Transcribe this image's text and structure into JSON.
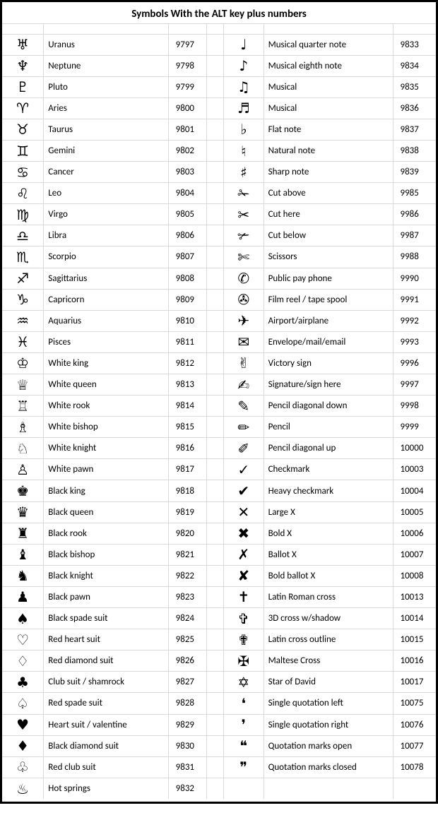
{
  "title": "Symbols With the ALT key plus numbers",
  "rows": [
    {
      "l": [
        "♅",
        "Uranus",
        "9797"
      ],
      "r": [
        "♩",
        "Musical quarter note",
        "9833"
      ]
    },
    {
      "l": [
        "♆",
        "Neptune",
        "9798"
      ],
      "r": [
        "♪",
        "Musical eighth note",
        "9834"
      ]
    },
    {
      "l": [
        "♇",
        "Pluto",
        "9799"
      ],
      "r": [
        "♫",
        "Musical",
        "9835"
      ]
    },
    {
      "l": [
        "♈",
        "Aries",
        "9800"
      ],
      "r": [
        "♬",
        "Musical",
        "9836"
      ]
    },
    {
      "l": [
        "♉",
        "Taurus",
        "9801"
      ],
      "r": [
        "♭",
        "Flat note",
        "9837"
      ]
    },
    {
      "l": [
        "♊",
        "Gemini",
        "9802"
      ],
      "r": [
        "♮",
        "Natural note",
        "9838"
      ]
    },
    {
      "l": [
        "♋",
        "Cancer",
        "9803"
      ],
      "r": [
        "♯",
        "Sharp note",
        "9839"
      ]
    },
    {
      "l": [
        "♌",
        "Leo",
        "9804"
      ],
      "r": [
        "✁",
        "Cut above",
        "9985"
      ]
    },
    {
      "l": [
        "♍",
        "Virgo",
        "9805"
      ],
      "r": [
        "✂",
        "Cut here",
        "9986"
      ]
    },
    {
      "l": [
        "♎",
        "Libra",
        "9806"
      ],
      "r": [
        "✃",
        "Cut below",
        "9987"
      ]
    },
    {
      "l": [
        "♏",
        "Scorpio",
        "9807"
      ],
      "r": [
        "✄",
        "Scissors",
        "9988"
      ]
    },
    {
      "l": [
        "♐",
        "Sagittarius",
        "9808"
      ],
      "r": [
        "✆",
        "Public pay phone",
        "9990"
      ]
    },
    {
      "l": [
        "♑",
        "Capricorn",
        "9809"
      ],
      "r": [
        "✇",
        "Film reel / tape spool",
        "9991"
      ]
    },
    {
      "l": [
        "♒",
        "Aquarius",
        "9810"
      ],
      "r": [
        "✈",
        "Airport/airplane",
        "9992"
      ]
    },
    {
      "l": [
        "♓",
        "Pisces",
        "9811"
      ],
      "r": [
        "✉",
        "Envelope/mail/email",
        "9993"
      ]
    },
    {
      "l": [
        "♔",
        "White king",
        "9812"
      ],
      "r": [
        "✌",
        "Victory sign",
        "9996"
      ]
    },
    {
      "l": [
        "♕",
        "White queen",
        "9813"
      ],
      "r": [
        "✍",
        "Signature/sign here",
        "9997"
      ]
    },
    {
      "l": [
        "♖",
        "White rook",
        "9814"
      ],
      "r": [
        "✎",
        "Pencil diagonal down",
        "9998"
      ]
    },
    {
      "l": [
        "♗",
        "White bishop",
        "9815"
      ],
      "r": [
        "✏",
        "Pencil",
        "9999"
      ]
    },
    {
      "l": [
        "♘",
        "White knight",
        "9816"
      ],
      "r": [
        "✐",
        "Pencil diagonal up",
        "10000"
      ]
    },
    {
      "l": [
        "♙",
        "White pawn",
        "9817"
      ],
      "r": [
        "✓",
        "Checkmark",
        "10003"
      ]
    },
    {
      "l": [
        "♚",
        "Black king",
        "9818"
      ],
      "r": [
        "✔",
        "Heavy checkmark",
        "10004"
      ]
    },
    {
      "l": [
        "♛",
        "Black queen",
        "9819"
      ],
      "r": [
        "✕",
        "Large X",
        "10005"
      ]
    },
    {
      "l": [
        "♜",
        "Black rook",
        "9820"
      ],
      "r": [
        "✖",
        "Bold X",
        "10006"
      ]
    },
    {
      "l": [
        "♝",
        "Black bishop",
        "9821"
      ],
      "r": [
        "✗",
        "Ballot X",
        "10007"
      ]
    },
    {
      "l": [
        "♞",
        "Black knight",
        "9822"
      ],
      "r": [
        "✘",
        "Bold ballot X",
        "10008"
      ]
    },
    {
      "l": [
        "♟",
        "Black pawn",
        "9823"
      ],
      "r": [
        "✝",
        "Latin Roman cross",
        "10013"
      ]
    },
    {
      "l": [
        "♠",
        "Black spade suit",
        "9824"
      ],
      "r": [
        "✞",
        "3D cross w/shadow",
        "10014"
      ]
    },
    {
      "l": [
        "♡",
        "Red heart suit",
        "9825"
      ],
      "r": [
        "✟",
        "Latin cross outline",
        "10015"
      ]
    },
    {
      "l": [
        "♢",
        "Red diamond suit",
        "9826"
      ],
      "r": [
        "✠",
        "Maltese Cross",
        "10016"
      ]
    },
    {
      "l": [
        "♣",
        "Club suit / shamrock",
        "9827"
      ],
      "r": [
        "✡",
        "Star of David",
        "10017"
      ]
    },
    {
      "l": [
        "♤",
        "Red spade suit",
        "9828"
      ],
      "r": [
        "❛",
        "Single quotation left",
        "10075"
      ]
    },
    {
      "l": [
        "♥",
        "Heart suit / valentine",
        "9829"
      ],
      "r": [
        "❜",
        "Single quotation right",
        "10076"
      ]
    },
    {
      "l": [
        "♦",
        "Black diamond suit",
        "9830"
      ],
      "r": [
        "❝",
        "Quotation marks open",
        "10077"
      ]
    },
    {
      "l": [
        "♧",
        "Red club suit",
        "9831"
      ],
      "r": [
        "❞",
        "Quotation marks closed",
        "10078"
      ]
    },
    {
      "l": [
        "♨",
        "Hot springs",
        "9832"
      ],
      "r": [
        "",
        "",
        ""
      ]
    }
  ]
}
